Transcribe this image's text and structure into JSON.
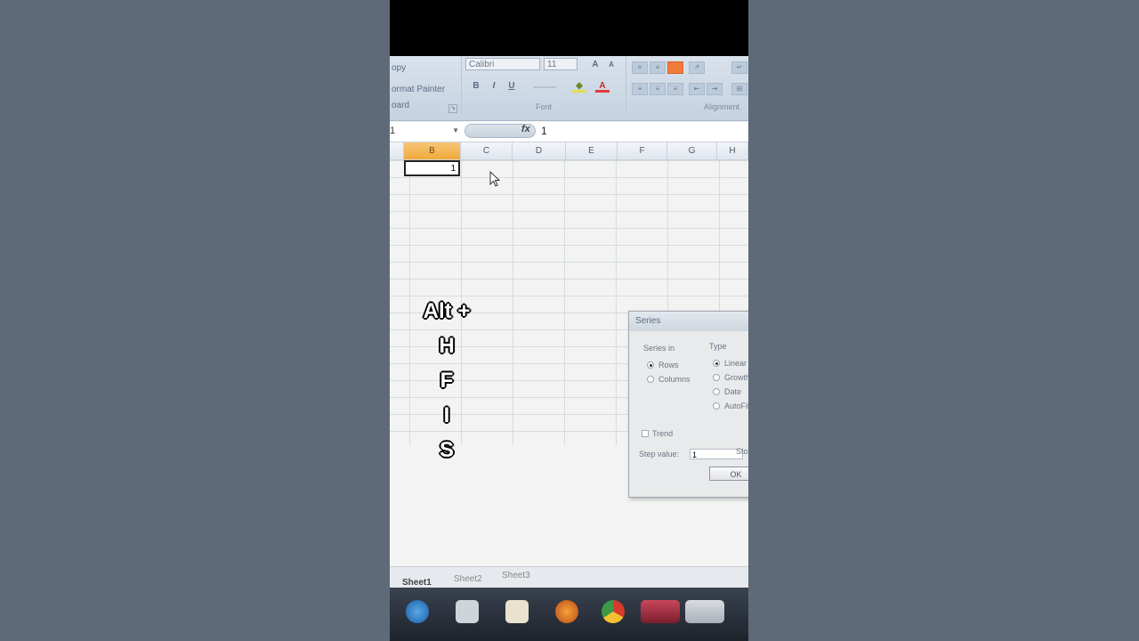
{
  "ribbon": {
    "clipboard": {
      "copy": "opy",
      "format_painter": "ormat Painter",
      "group_label": "oard"
    },
    "font": {
      "name": "Calibri",
      "size": "11",
      "bold": "B",
      "italic": "I",
      "underline": "U",
      "group_label": "Font"
    },
    "alignment": {
      "group_label": "Alignment"
    }
  },
  "formula_bar": {
    "name_box": "1",
    "fx": "fx",
    "value": "1"
  },
  "grid": {
    "columns": [
      "B",
      "C",
      "D",
      "E",
      "F",
      "G",
      "H"
    ],
    "selected_column": "B",
    "active_cell_value": "1"
  },
  "overlay_keys": [
    "Alt +",
    "H",
    "F",
    "I",
    "S"
  ],
  "series_dialog": {
    "title": "Series",
    "series_in_label": "Series in",
    "rows": "Rows",
    "columns": "Columns",
    "type_label": "Type",
    "linear": "Linear",
    "growth": "Growth",
    "date": "Date",
    "autofill": "AutoFill",
    "trend": "Trend",
    "step_label": "Step value:",
    "step_value": "1",
    "stop_label": "Sto",
    "ok": "OK"
  },
  "sheet_tabs": [
    "Sheet1",
    "Sheet2",
    "Sheet3"
  ]
}
